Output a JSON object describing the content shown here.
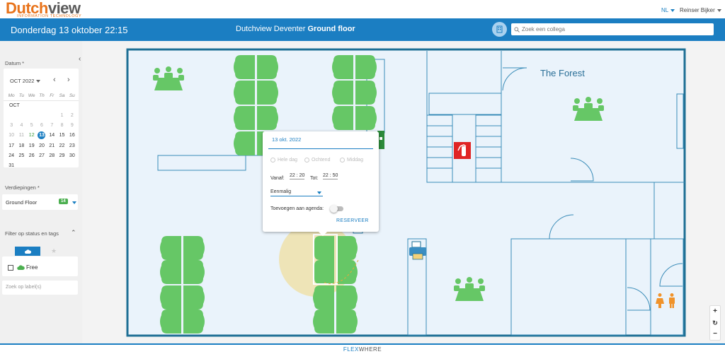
{
  "brand": {
    "part1": "Dutch",
    "part2": "view",
    "tagline": "INFORMATION TECHNOLOGY"
  },
  "topbar": {
    "language": "NL",
    "user": "Reinser Bijker"
  },
  "header": {
    "date_text": "Donderdag 13 oktober 22:15",
    "location": "Dutchview Deventer",
    "floor": "Ground floor",
    "search_placeholder": "Zoek een collega"
  },
  "sidebar": {
    "date_label": "Datum *",
    "calendar": {
      "month_label": "OCT 2022",
      "days_of_week": [
        "Mo",
        "Tu",
        "We",
        "Th",
        "Fr",
        "Sa",
        "Su"
      ],
      "month_abbr": "OCT",
      "weeks": [
        [
          "",
          "",
          "",
          "",
          "",
          "1",
          "2"
        ],
        [
          "3",
          "4",
          "5",
          "6",
          "7",
          "8",
          "9"
        ],
        [
          "10",
          "11",
          "12",
          "13",
          "14",
          "15",
          "16"
        ],
        [
          "17",
          "18",
          "19",
          "20",
          "21",
          "22",
          "23"
        ],
        [
          "24",
          "25",
          "26",
          "27",
          "28",
          "29",
          "30"
        ],
        [
          "31",
          "",
          "",
          "",
          "",
          "",
          ""
        ]
      ],
      "selected_day": "13"
    },
    "floors_label": "Verdiepingen *",
    "floor_value": "Ground Floor",
    "floor_badge": "14",
    "filter_label": "Filter op status en tags",
    "filter_free_label": "Free",
    "tag_search_placeholder": "Zoek op label(s)"
  },
  "map": {
    "room_name": "The Forest"
  },
  "popup": {
    "date": "13 okt. 2022",
    "options": [
      "Hele dag",
      "Ochtend",
      "Middag"
    ],
    "from_label": "Vanaf:",
    "from_hour": "22",
    "from_min": "20",
    "to_label": "Tot:",
    "to_hour": "22",
    "to_min": "50",
    "recurrence": "Eenmalig",
    "agenda_label": "Toevoegen aan agenda:",
    "reserve_label": "RESERVEER"
  },
  "zoom": {
    "in": "+",
    "reset": "↻",
    "out": "−"
  },
  "footer": {
    "part1": "FLEX",
    "part2": "WHERE"
  },
  "colors": {
    "accent": "#1b7ec2",
    "desk": "#66c766",
    "wall": "#1e6f94",
    "floor": "#eaf3fb"
  }
}
